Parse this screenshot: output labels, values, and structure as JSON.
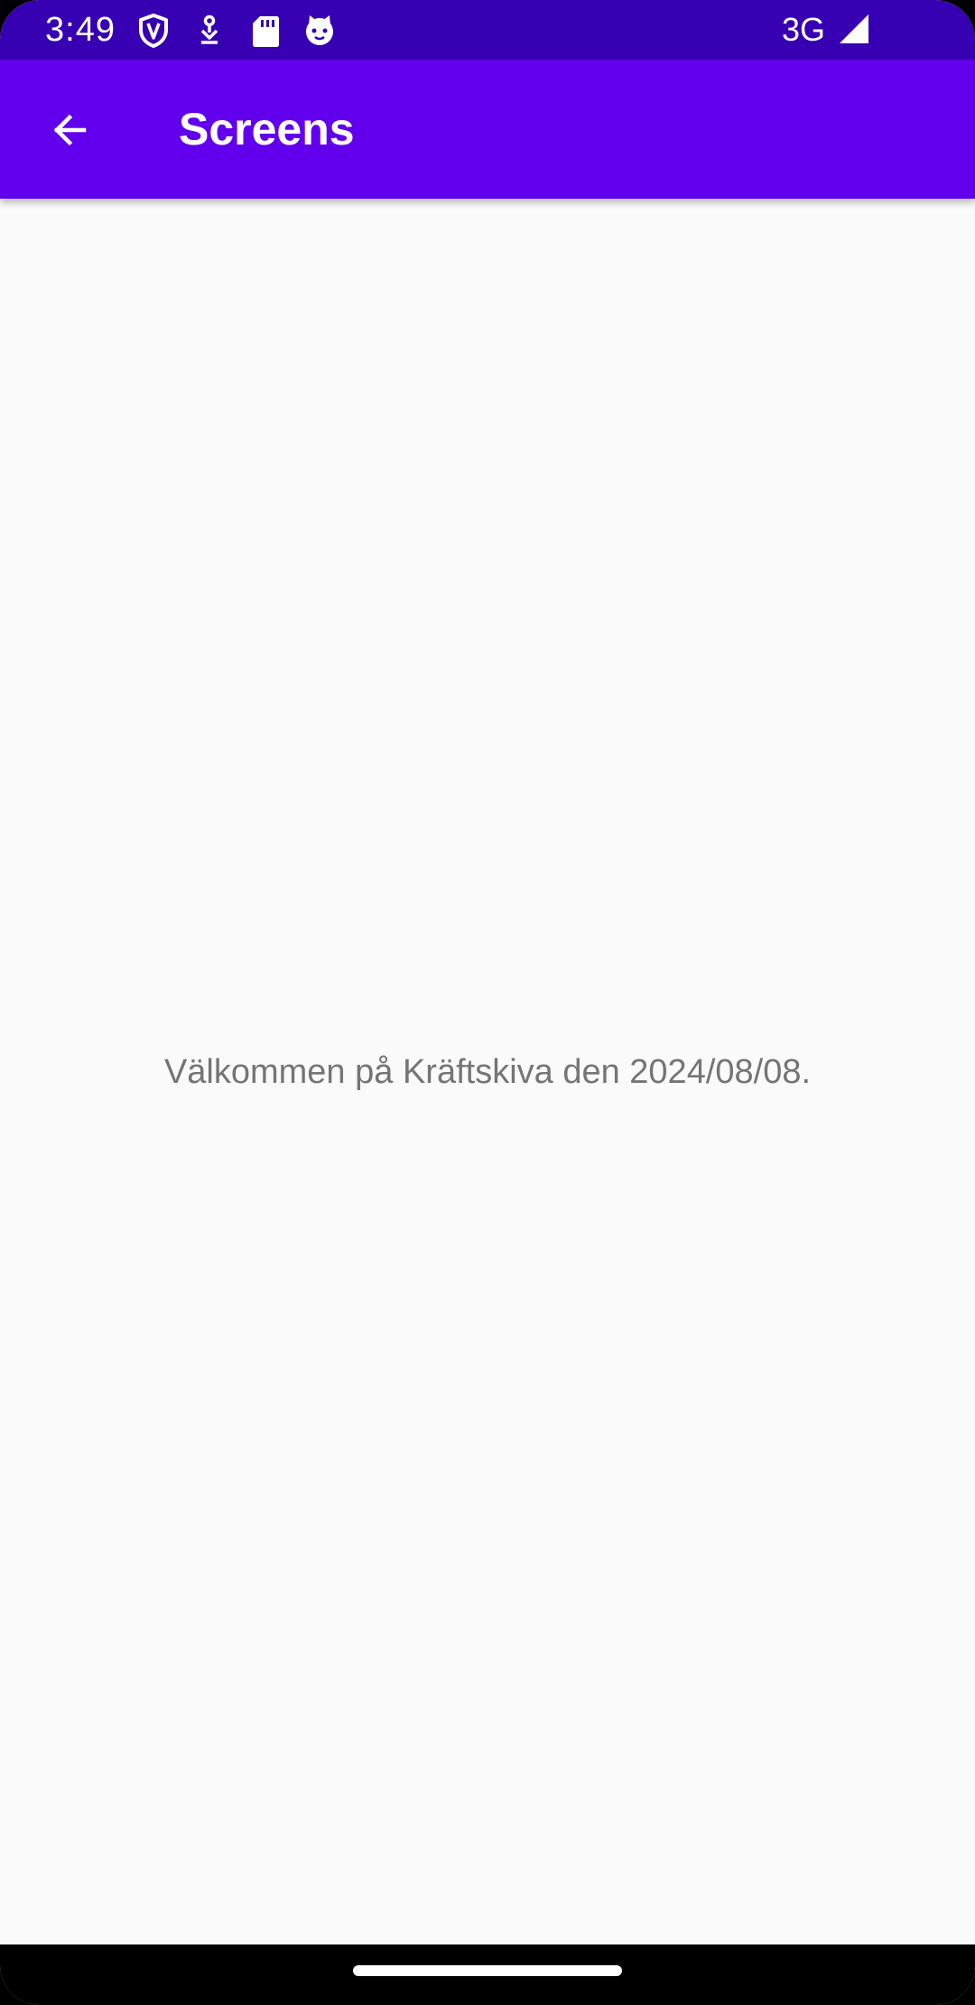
{
  "status_bar": {
    "time": "3:49",
    "network": "3G",
    "icons": [
      "shield-icon",
      "download-icon",
      "sd-card-icon",
      "cat-face-icon",
      "signal-icon"
    ]
  },
  "app_bar": {
    "back_icon": "arrow-back-icon",
    "title": "Screens"
  },
  "content": {
    "message": "Välkommen på Kräftskiva den 2024/08/08."
  },
  "colors": {
    "status_bar": "#3700b3",
    "app_bar": "#6200ee",
    "background": "#fafafa",
    "text_secondary": "#757575"
  }
}
